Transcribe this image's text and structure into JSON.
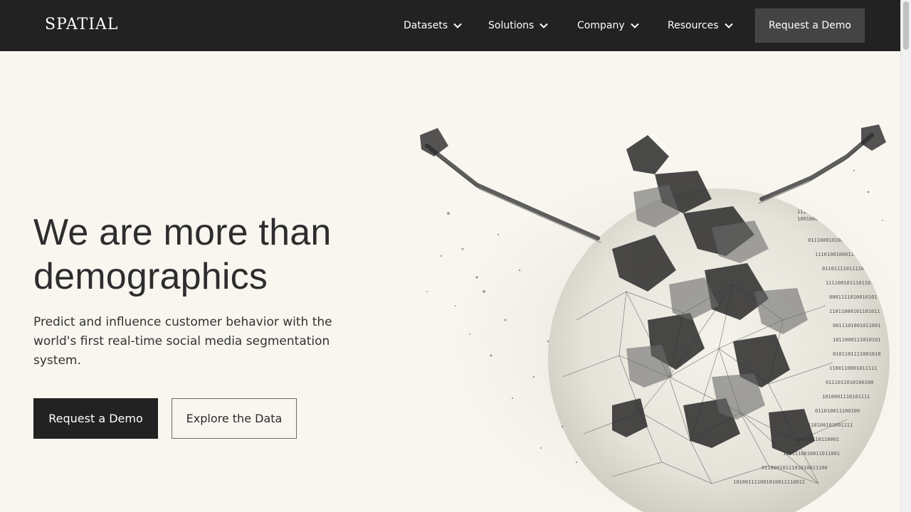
{
  "header": {
    "logo": "SPATIAL",
    "nav": [
      {
        "label": "Datasets"
      },
      {
        "label": "Solutions"
      },
      {
        "label": "Company"
      },
      {
        "label": "Resources"
      }
    ],
    "cta_label": "Request a Demo"
  },
  "hero": {
    "title_line1": "We are more than",
    "title_line2": "demographics",
    "subtitle": "Predict and influence customer behavior with the world's first real-time social media segmentation system.",
    "primary_button": "Request a Demo",
    "secondary_button": "Explore the Data",
    "illustration_icon": "person-globe-network-illustration"
  },
  "colors": {
    "header_bg": "#222222",
    "page_bg": "#f8f6ef",
    "primary_button_bg": "#222222",
    "nav_cta_bg": "#444444"
  }
}
